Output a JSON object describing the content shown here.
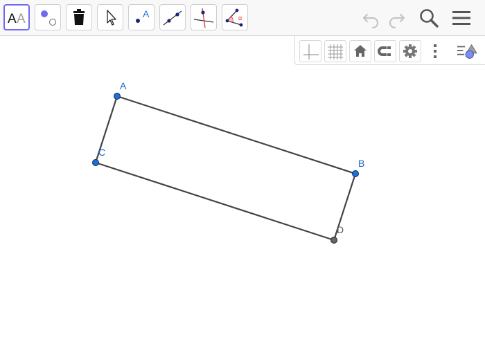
{
  "toolbar": {
    "tools": [
      {
        "name": "style-tool",
        "icon": "text-style-icon",
        "selected": true
      },
      {
        "name": "point-style-tool",
        "icon": "point-style-icon"
      },
      {
        "name": "delete-tool",
        "icon": "trash-icon"
      },
      {
        "name": "move-tool",
        "icon": "cursor-arrow-icon"
      },
      {
        "name": "point-tool",
        "icon": "point-icon",
        "label": "A"
      },
      {
        "name": "line-tool",
        "icon": "line-icon"
      },
      {
        "name": "perpendicular-line-tool",
        "icon": "perpendicular-line-icon"
      },
      {
        "name": "angle-tool",
        "icon": "angle-icon",
        "label": "α"
      }
    ],
    "style_glyph_dark": "A",
    "style_glyph_light": "A",
    "undo_icon": "undo-icon",
    "redo_icon": "redo-icon",
    "search_icon": "search-icon",
    "menu_icon": "menu-icon"
  },
  "style_bar": {
    "buttons": [
      "axes-icon",
      "grid-icon",
      "home-icon",
      "magnet-icon",
      "gear-icon",
      "more-vertical-icon",
      "style-bar-toggle-icon"
    ]
  },
  "construction": {
    "points": [
      {
        "label": "A",
        "color": "#1565c0",
        "fill": "#1e6fd9"
      },
      {
        "label": "B",
        "color": "#1565c0",
        "fill": "#1e6fd9"
      },
      {
        "label": "C",
        "color": "#1565c0",
        "fill": "#1e6fd9"
      },
      {
        "label": "D",
        "color": "#555555",
        "fill": "#666666"
      }
    ],
    "segment_color": "#444444"
  },
  "colors": {
    "accent": "#6e6bf0",
    "point_blue": "#1e6fd9",
    "point_gray": "#666666"
  }
}
